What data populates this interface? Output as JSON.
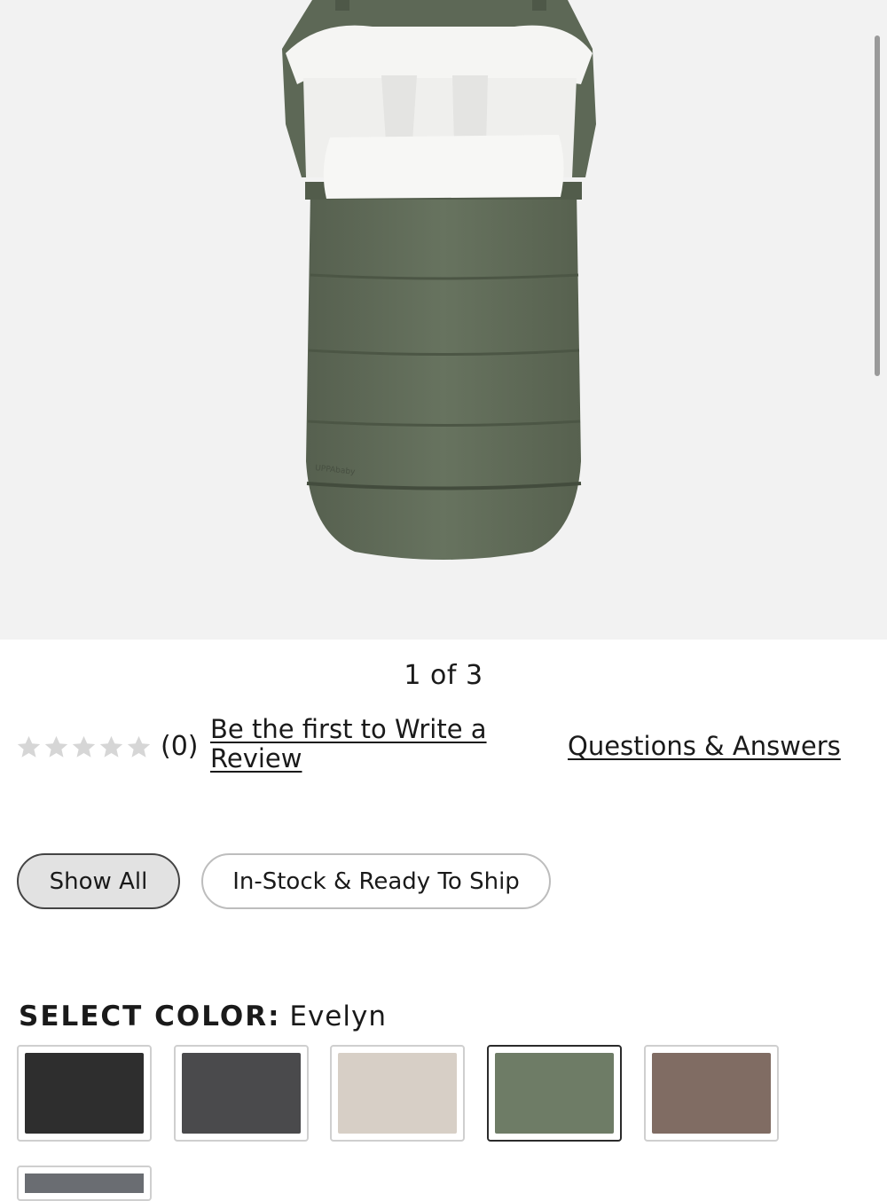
{
  "gallery": {
    "image_alt": "Green footmuff product image",
    "brand_mark": "UPPAbaby",
    "counter": "1 of 3"
  },
  "reviews": {
    "rating": 0,
    "max_rating": 5,
    "count_text": "(0)",
    "write_review_label": "Be the first to Write a Review",
    "qa_label": "Questions & Answers"
  },
  "filters": {
    "show_all_label": "Show All",
    "in_stock_label": "In-Stock & Ready To Ship",
    "active": "Show All"
  },
  "color_select": {
    "heading_label": "SELECT COLOR:",
    "selected_color": "Evelyn",
    "swatches": [
      {
        "color": "#2e2e2e",
        "selected": false
      },
      {
        "color": "#4a4a4c",
        "selected": false
      },
      {
        "color": "#d7cfc6",
        "selected": false
      },
      {
        "color": "#6e7c66",
        "selected": true
      },
      {
        "color": "#806c63",
        "selected": false
      },
      {
        "color": "#6a6d72",
        "selected": false
      }
    ]
  },
  "colors": {
    "star_empty": "#d6d6d6",
    "footmuff_green": "#5f6b58",
    "fleece": "#f4f4f2",
    "gallery_bg": "#f2f2f2"
  }
}
